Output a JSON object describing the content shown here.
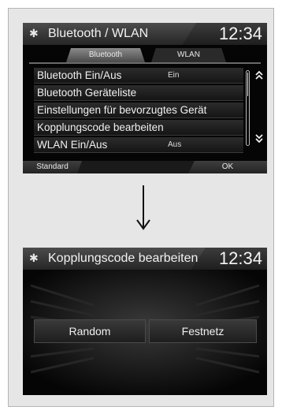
{
  "screen1": {
    "title": "Bluetooth / WLAN",
    "clock": "12:34",
    "tabs": [
      {
        "label": "Bluetooth",
        "active": true
      },
      {
        "label": "WLAN",
        "active": false
      }
    ],
    "items": [
      {
        "label": "Bluetooth Ein/Aus",
        "value": "Ein"
      },
      {
        "label": "Bluetooth Geräteliste",
        "value": ""
      },
      {
        "label": "Einstellungen für bevorzugtes Gerät",
        "value": ""
      },
      {
        "label": "Kopplungscode bearbeiten",
        "value": ""
      },
      {
        "label": "WLAN Ein/Aus",
        "value": "Aus"
      }
    ],
    "buttons": {
      "standard": "Standard",
      "ok": "OK"
    },
    "icons": {
      "settings": "gear-icon",
      "scroll_up": "chevron-up-icon",
      "scroll_down": "chevron-down-icon"
    }
  },
  "transition": {
    "icon": "down-arrow-icon"
  },
  "screen2": {
    "title": "Kopplungscode bearbeiten",
    "clock": "12:34",
    "options": [
      {
        "label": "Random"
      },
      {
        "label": "Festnetz"
      }
    ],
    "icons": {
      "settings": "gear-icon"
    }
  },
  "colors": {
    "screen_bg": "#050505",
    "panel_bg": "#e6e6e6",
    "text": "#f0f0f0"
  }
}
